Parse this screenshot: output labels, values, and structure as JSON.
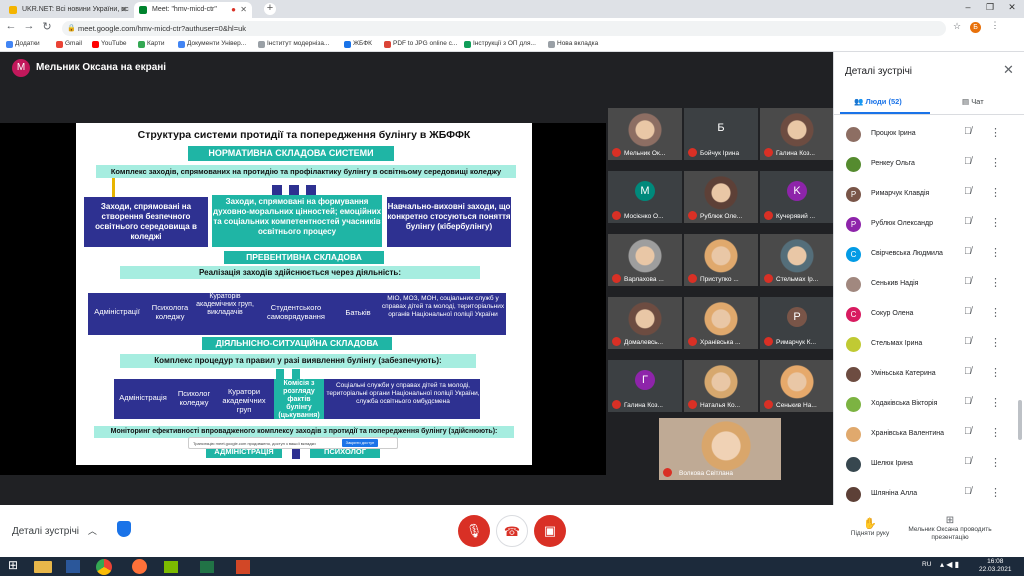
{
  "browser": {
    "tabs": [
      {
        "title": "UKR.NET: Всі новини України, ос",
        "active": false
      },
      {
        "title": "Meet: \"hmv-micd-ctr\"",
        "active": true
      },
      {
        "title": "",
        "active": false
      }
    ],
    "url": "meet.google.com/hmv-micd-ctr?authuser=0&hl=uk",
    "bookmarks": [
      "Додатки",
      "Gmail",
      "YouTube",
      "Карти",
      "Документи Універ...",
      "Інститут модерніза...",
      "ЖБФК",
      "PDF to JPG online c...",
      "Інструкції з ОП для...",
      "Нова вкладка"
    ],
    "nav_icons": [
      "back-icon",
      "forward-icon",
      "reload-icon",
      "lock-icon"
    ]
  },
  "meet": {
    "presenter_banner": "Мельник Оксана на екрані",
    "presenter_initial": "M",
    "slide": {
      "title": "Структура системи протидії та попередження булінгу в ЖБФФК",
      "section1": "НОРМАТИВНА СКЛАДОВА СИСТЕМИ",
      "complex1": "Комплекс заходів, спрямованих на протидію та профілактику булінгу в освітньому середовищі коледжу",
      "box1": "Заходи, спрямовані на створення безпечного освітнього середовища в коледжі",
      "box2": "Заходи, спрямовані на формування духовно-моральних цінностей; емоційних та соціальних компетентностей учасників освітнього процесу",
      "box3": "Навчально-виховні заходи, що конкретно стосуються поняття булінгу (кібербулінгу)",
      "section2": "ПРЕВЕНТИВНА СКЛАДОВА",
      "realization": "Реалізація заходів здійснюється через діяльність:",
      "actors1": [
        "Адміністрації",
        "Психолога коледжу",
        "Кураторів академічних груп, викладачів",
        "Студентського самоврядування",
        "Батьків",
        "МІО, МОЗ, МОН, соціальних служб у справах дітей та молоді, територіальних органів Національної поліції України"
      ],
      "section3": "ДІЯЛЬНІСНО-СИТУАЦІЙНА СКЛАДОВА",
      "complex2": "Комплекс процедур та правил у разі виявлення булінгу (забезпечують):",
      "actors2": [
        "Адміністрація",
        "Психолог коледжу",
        "Куратори академічних груп",
        "Комісія з розгляду фактів булінгу (цькування)",
        "Соціальні служби у справах дітей та молоді, територіальні органи Національної поліції України, служба освітнього омбудсмена"
      ],
      "monitoring": "Моніторинг ефективності впровадженого комплексу заходів з протидії та попередження булінгу (здійснюють):",
      "bottom_left": "АДМІНІСТРАЦІЯ",
      "bottom_right": "ПСИХОЛОГ",
      "share_notice": "Трансляцію meet.google.com продовжено, доступ з вашої вкладки",
      "share_stop": "Закрити доступ"
    },
    "tiles": [
      {
        "name": "Мельник Ок...",
        "initial": "",
        "color": "#8d6e63",
        "photo": true
      },
      {
        "name": "Бойчук Ірина",
        "initial": "Б",
        "color": "#3c4043",
        "photo": false
      },
      {
        "name": "Галина Коз...",
        "initial": "",
        "color": "#6d4c41",
        "photo": true
      },
      {
        "name": "Мосієнко О...",
        "initial": "M",
        "color": "#00897b",
        "photo": false
      },
      {
        "name": "Рублюк Оле...",
        "initial": "",
        "color": "#5d4037",
        "photo": true
      },
      {
        "name": "Кучерявий ...",
        "initial": "K",
        "color": "#8e24aa",
        "photo": false
      },
      {
        "name": "Варлахова ...",
        "initial": "",
        "color": "#9e9e9e",
        "photo": true
      },
      {
        "name": "Приступко ...",
        "initial": "",
        "color": "#e0a96d",
        "photo": true
      },
      {
        "name": "Стельмах Ір...",
        "initial": "",
        "color": "#546e7a",
        "photo": true
      },
      {
        "name": "Домалевсь...",
        "initial": "",
        "color": "#6d4c41",
        "photo": true
      },
      {
        "name": "Хранівська ...",
        "initial": "",
        "color": "#e0a96d",
        "photo": true
      },
      {
        "name": "Римарчук К...",
        "initial": "P",
        "color": "#795548",
        "photo": false
      },
      {
        "name": "Галина Коз...",
        "initial": "Г",
        "color": "#8e24aa",
        "photo": false
      },
      {
        "name": "Наталья Ко...",
        "initial": "",
        "color": "#d7a86e",
        "photo": true
      },
      {
        "name": "Сенькив На...",
        "initial": "",
        "color": "#e6a96b",
        "photo": true
      }
    ],
    "featured_tile": {
      "name": "Волкова Світлана"
    },
    "details_label": "Деталі зустрічі",
    "controls": [
      "mic-off-icon",
      "hangup-icon",
      "camera-off-icon"
    ]
  },
  "panel": {
    "title": "Деталі зустрічі",
    "tab_people": "Люди (52)",
    "tab_chat": "Чат",
    "people": [
      {
        "name": "Процюк Ірина",
        "initial": "",
        "color": "#8d6e63"
      },
      {
        "name": "Ренкеу Ольга",
        "initial": "",
        "color": "#558b2f"
      },
      {
        "name": "Римарчук Клавдія",
        "initial": "P",
        "color": "#795548"
      },
      {
        "name": "Рублюк Олександр",
        "initial": "P",
        "color": "#8e24aa"
      },
      {
        "name": "Свірчевська Людмила",
        "initial": "C",
        "color": "#039be5"
      },
      {
        "name": "Сенькив Надія",
        "initial": "",
        "color": "#a1887f"
      },
      {
        "name": "Сокур Олена",
        "initial": "C",
        "color": "#d81b60"
      },
      {
        "name": "Стельмах Ірина",
        "initial": "",
        "color": "#c0ca33"
      },
      {
        "name": "Уміньська Катерина",
        "initial": "",
        "color": "#6d4c41"
      },
      {
        "name": "Ходаківська Вікторія",
        "initial": "",
        "color": "#7cb342"
      },
      {
        "name": "Хранівська Валентина",
        "initial": "",
        "color": "#e0a96d"
      },
      {
        "name": "Шелюк Ірина",
        "initial": "",
        "color": "#37474f"
      },
      {
        "name": "Шляніна Алла",
        "initial": "",
        "color": "#5d4037"
      }
    ],
    "raise_hand": "Підняти руку",
    "presenting": "Мельник Оксана проводить презентацію"
  },
  "taskbar": {
    "lang": "RU",
    "time": "16:08",
    "date": "22.03.2021"
  }
}
